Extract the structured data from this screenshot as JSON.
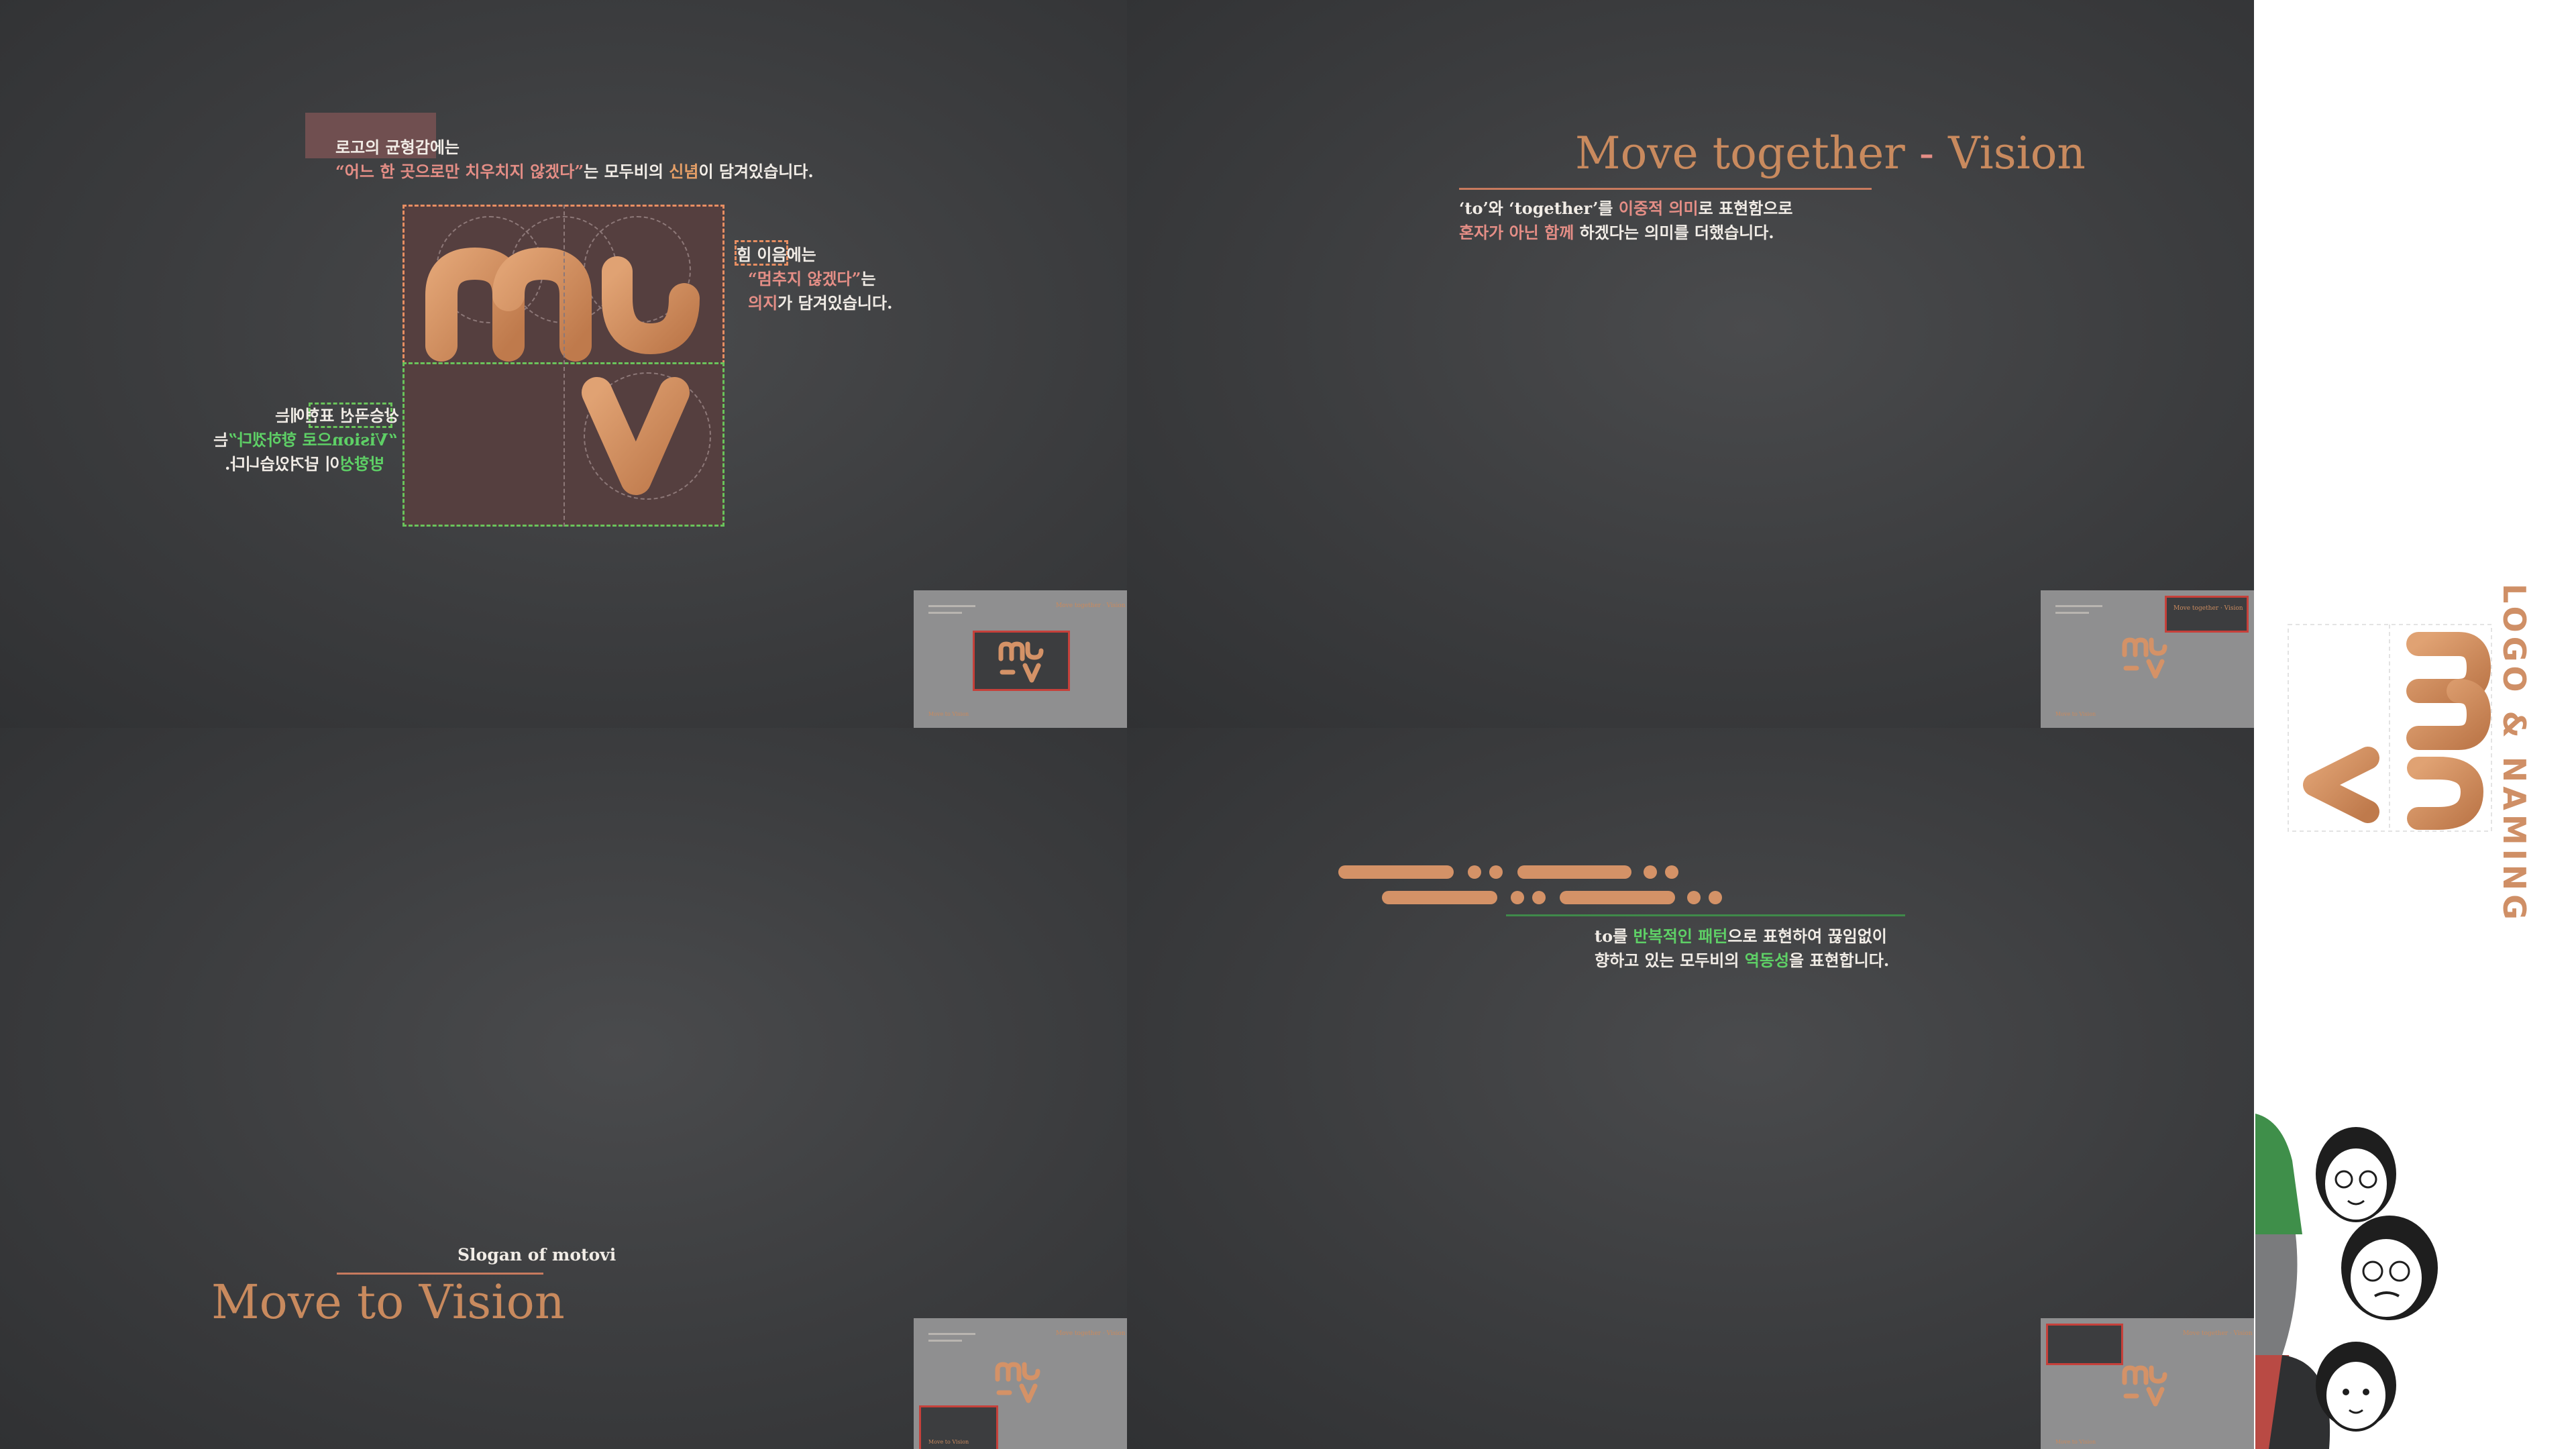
{
  "panel1": {
    "caption": {
      "line1": "로고의 균형감에는",
      "line2_quote": "“어느 한 곳으로만 치우치지 않겠다”",
      "line2_mid": "는 모두비의 ",
      "line2_belief": "신념",
      "line2_end": "이 담겨있습니다."
    },
    "right_note": {
      "line1": "힘 이음에는",
      "line2": "“멈추지 않겠다”",
      "line2_end": "는",
      "line3_will": "의지",
      "line3_end": "가 담겨있습니다."
    },
    "left_note_mirrored": {
      "line1": "상승곡선 표현에는",
      "line2_quote": "“Vision으로 향하겠다”",
      "line2_end": "는",
      "line3_dir": "방향성",
      "line3_end": "이 담겨있습니다."
    }
  },
  "panel2": {
    "title_main": "Move together",
    "title_dash": " - ",
    "title_vision": "Vision",
    "line1_a": "‘to’와 ‘together’를 ",
    "line1_b": "이중적 의미",
    "line1_c": "로 표현함으로",
    "line2_a": "혼자가 아닌 함께",
    "line2_b": " 하겠다는 의미를 더했습니다."
  },
  "panel3": {
    "subtitle": "Slogan of motovi",
    "title": "Move to Vision"
  },
  "panel4": {
    "line1_a": "to를 ",
    "line1_b": "반복적인 패턴",
    "line1_c": "으로 표현하여 끊임없이",
    "line2_a": "향하고 있는 모두비의 ",
    "line2_b": "역동성",
    "line2_c": "을 표현합니다."
  },
  "thumbnails": {
    "t1_title": "Move together · Vision",
    "t2_title": "Move together · Vision",
    "t3_title": "Move together · Vision",
    "t4_title": "Move together · Vision",
    "footer": "Move to Vision"
  },
  "sidebar": {
    "vertical_title": "LOGO & NAMING"
  },
  "colors": {
    "copper": "#c98a5e",
    "accent_pink": "#e58e86",
    "accent_green": "#5ed066",
    "panel_bg": "#3b3c3e"
  },
  "icons": [
    "mv-logo-icon",
    "three-people-illustration"
  ]
}
